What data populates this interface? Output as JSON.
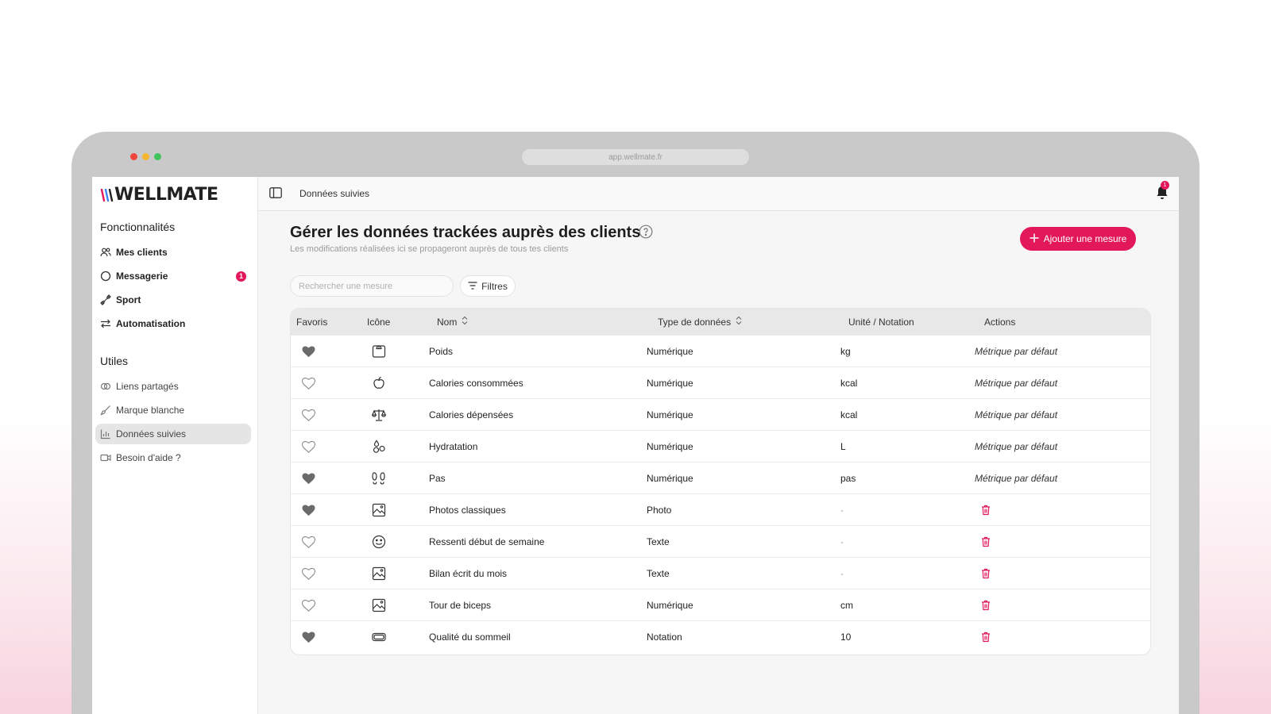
{
  "browser": {
    "url": "app.wellmate.fr"
  },
  "brand": {
    "name": "WELLMATE",
    "accent": "#e2185a"
  },
  "sidebar": {
    "section_features": "Fonctionnalités",
    "features": [
      {
        "label": "Mes clients",
        "icon": "users-icon"
      },
      {
        "label": "Messagerie",
        "icon": "message-circle-icon",
        "badge": "1"
      },
      {
        "label": "Sport",
        "icon": "dumbbell-icon"
      },
      {
        "label": "Automatisation",
        "icon": "arrows-exchange-icon"
      }
    ],
    "section_utils": "Utiles",
    "utils": [
      {
        "label": "Liens partagés",
        "icon": "link-icon"
      },
      {
        "label": "Marque blanche",
        "icon": "brush-icon"
      },
      {
        "label": "Données suivies",
        "icon": "bar-chart-icon",
        "active": true
      },
      {
        "label": "Besoin d'aide ?",
        "icon": "video-icon"
      }
    ]
  },
  "topbar": {
    "breadcrumb": "Données suivies",
    "notifications": "1"
  },
  "page": {
    "title": "Gérer les données trackées auprès des clients",
    "subtitle": "Les modifications réalisées ici se propageront auprès de tous tes clients",
    "add_button": "Ajouter une mesure",
    "search_placeholder": "Rechercher une mesure",
    "filters_label": "Filtres"
  },
  "table": {
    "columns": {
      "favoris": "Favoris",
      "icone": "Icône",
      "nom": "Nom",
      "type": "Type de données",
      "unite": "Unité / Notation",
      "actions": "Actions"
    },
    "rows": [
      {
        "fav": true,
        "icon": "scale-icon",
        "name": "Poids",
        "type": "Numérique",
        "unit": "kg",
        "action": "Métrique par défaut"
      },
      {
        "fav": false,
        "icon": "apple-icon",
        "name": "Calories consommées",
        "type": "Numérique",
        "unit": "kcal",
        "action": "Métrique par défaut"
      },
      {
        "fav": false,
        "icon": "balance-icon",
        "name": "Calories dépensées",
        "type": "Numérique",
        "unit": "kcal",
        "action": "Métrique par défaut"
      },
      {
        "fav": false,
        "icon": "drops-icon",
        "name": "Hydratation",
        "type": "Numérique",
        "unit": "L",
        "action": "Métrique par défaut"
      },
      {
        "fav": true,
        "icon": "footprints-icon",
        "name": "Pas",
        "type": "Numérique",
        "unit": "pas",
        "action": "Métrique par défaut"
      },
      {
        "fav": true,
        "icon": "image-icon",
        "name": "Photos classiques",
        "type": "Photo",
        "unit": "-",
        "action": ""
      },
      {
        "fav": false,
        "icon": "smiley-icon",
        "name": "Ressenti début de semaine",
        "type": "Texte",
        "unit": "-",
        "action": ""
      },
      {
        "fav": false,
        "icon": "image-icon",
        "name": "Bilan écrit du mois",
        "type": "Texte",
        "unit": "-",
        "action": ""
      },
      {
        "fav": false,
        "icon": "image-icon",
        "name": "Tour de biceps",
        "type": "Numérique",
        "unit": "cm",
        "action": ""
      },
      {
        "fav": true,
        "icon": "battery-icon",
        "name": "Qualité du sommeil",
        "type": "Notation",
        "unit": "10",
        "action": ""
      }
    ]
  }
}
